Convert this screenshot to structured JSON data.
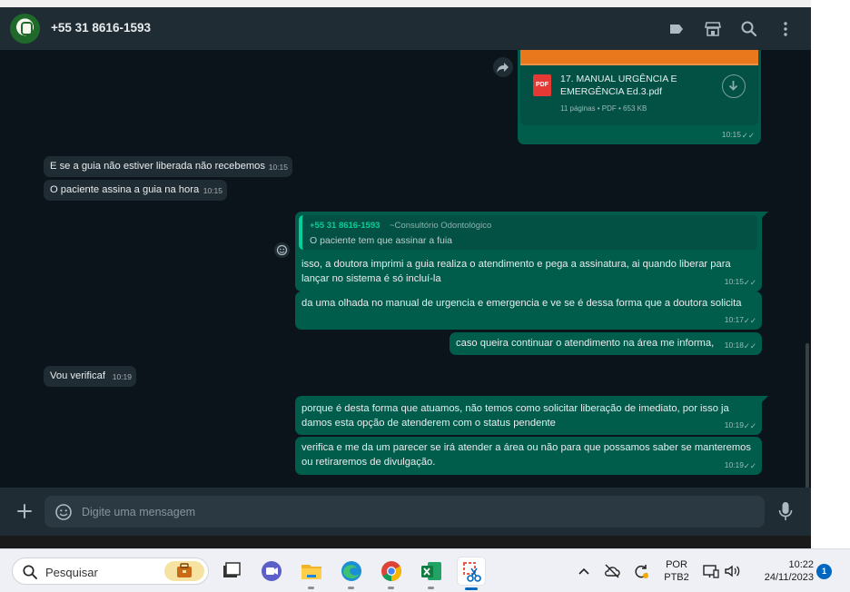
{
  "header": {
    "contact": "+55 31 8616-1593",
    "icons": [
      "label-icon",
      "catalog-icon",
      "search-icon",
      "menu-icon"
    ]
  },
  "colors": {
    "chat_bg": "#0b141a",
    "panel": "#202c33",
    "incoming": "#202c33",
    "outgoing": "#005c4b",
    "accent": "#06cf9c"
  },
  "pdf": {
    "name": "17. MANUAL URGÊNCIA E EMERGÊNCIA Ed.3.pdf",
    "meta": "11 páginas • PDF • 653 KB",
    "badge": "PDF",
    "time": "10:15"
  },
  "messages": [
    {
      "text": "E se a guia não estiver liberada não recebemos",
      "time": "10:15"
    },
    {
      "text": "O paciente assina a guia na hora",
      "time": "10:15"
    },
    {
      "quote_author": "+55 31 8616-1593",
      "quote_tag": "~Consultório Odontológico",
      "quote_text": "O paciente tem que assinar a fuia",
      "text": "isso, a doutora imprimi a guia realiza o atendimento e pega a assinatura, ai quando liberar para lançar no sistema é só incluí-la",
      "time": "10:15"
    },
    {
      "text": "da uma olhada no manual de urgencia e emergencia e ve se é dessa forma que a doutora solicita",
      "time": "10:17"
    },
    {
      "text": "caso queira continuar o atendimento na área me informa,",
      "time": "10:18"
    },
    {
      "text": "Vou verificaf",
      "time": "10:19"
    },
    {
      "text": "porque é desta forma que atuamos, não temos como solicitar liberação de imediato, por isso ja damos esta opção de atenderem com o status pendente",
      "time": "10:19"
    },
    {
      "text": "verifica e me da um parecer se irá atender a área ou não para que possamos saber se manteremos ou retiraremos de divulgação.",
      "time": "10:19"
    }
  ],
  "compose": {
    "placeholder": "Digite uma mensagem"
  },
  "taskbar": {
    "search_label": "Pesquisar",
    "apps": [
      "task-view",
      "meet-app",
      "file-explorer",
      "edge-browser",
      "chrome-browser",
      "excel-app",
      "snipping-tool"
    ],
    "lang_line1": "POR",
    "lang_line2": "PTB2",
    "time": "10:22",
    "date": "24/11/2023",
    "notifications": "1"
  }
}
